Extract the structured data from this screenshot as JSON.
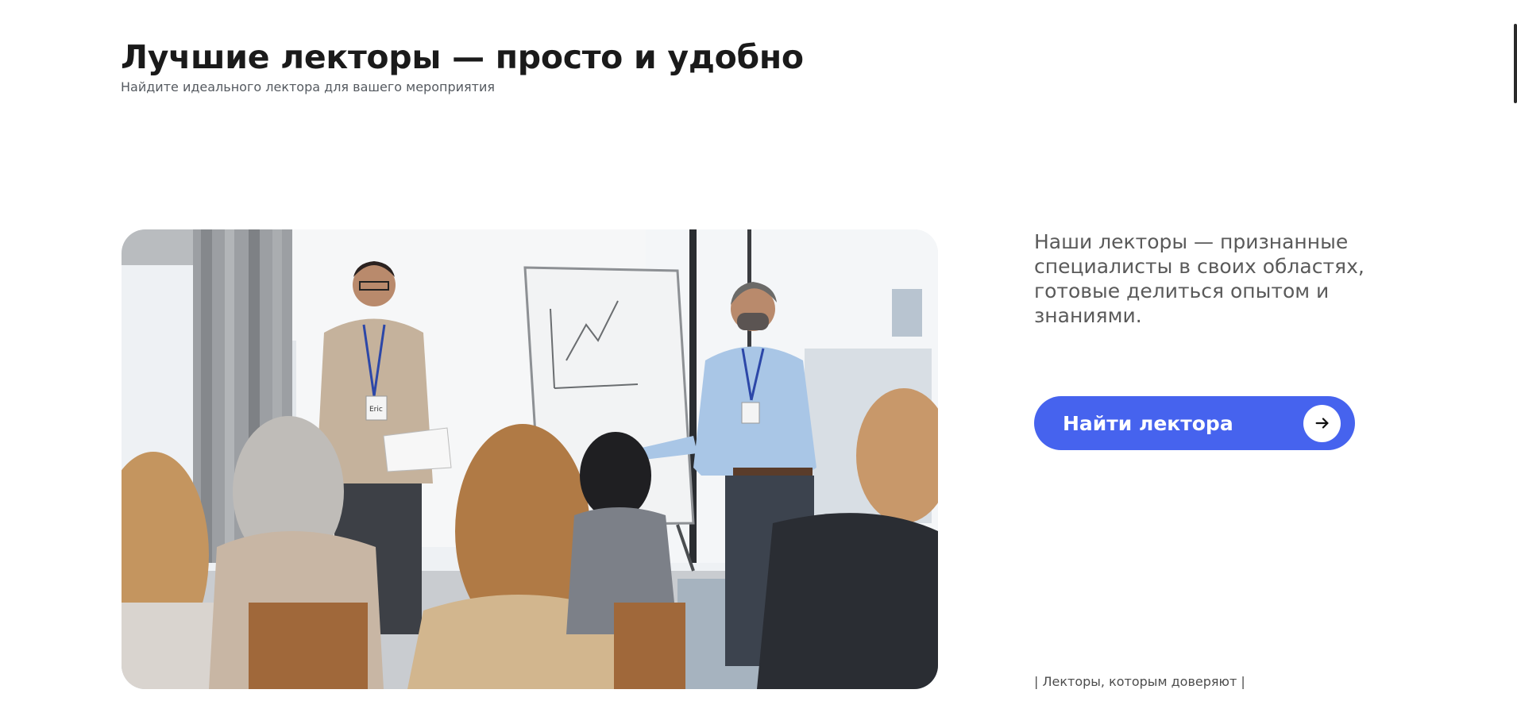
{
  "header": {
    "title": "Лучшие лекторы — просто и удобно",
    "subtitle": "Найдите идеального лектора для вашего мероприятия"
  },
  "hero": {
    "intro": "Наши лекторы — признанные специалисты в своих областях, готовые делиться опытом и знаниями.",
    "cta_label": "Найти лектора",
    "cta_icon": "arrow-right-icon",
    "trust_caption": "| Лекторы, которым доверяют |",
    "photo_badge_name": "Eric"
  },
  "colors": {
    "accent": "#4663ee",
    "title": "#1a1a1a",
    "muted": "#5a5a5a"
  }
}
